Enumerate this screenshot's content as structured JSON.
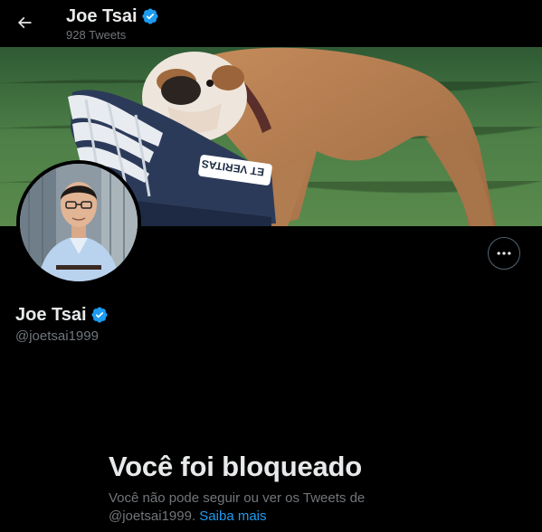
{
  "header": {
    "name": "Joe Tsai",
    "tweet_count": "928 Tweets"
  },
  "banner": {
    "helmet_text": "ET VERITAS"
  },
  "profile": {
    "name": "Joe Tsai",
    "handle": "@joetsai1999",
    "verified": true
  },
  "blocked": {
    "title": "Você foi bloqueado",
    "message": "Você não pode seguir ou ver os Tweets de @joetsai1999.",
    "learn_more": "Saiba mais"
  },
  "colors": {
    "background": "#000000",
    "text_primary": "#e7e9ea",
    "text_secondary": "#71767b",
    "accent": "#1d9bf0",
    "verified_badge": "#1d9bf0"
  },
  "icons": {
    "back": "arrow-left-icon",
    "verified": "verified-badge-icon",
    "more": "more-horizontal-icon"
  }
}
